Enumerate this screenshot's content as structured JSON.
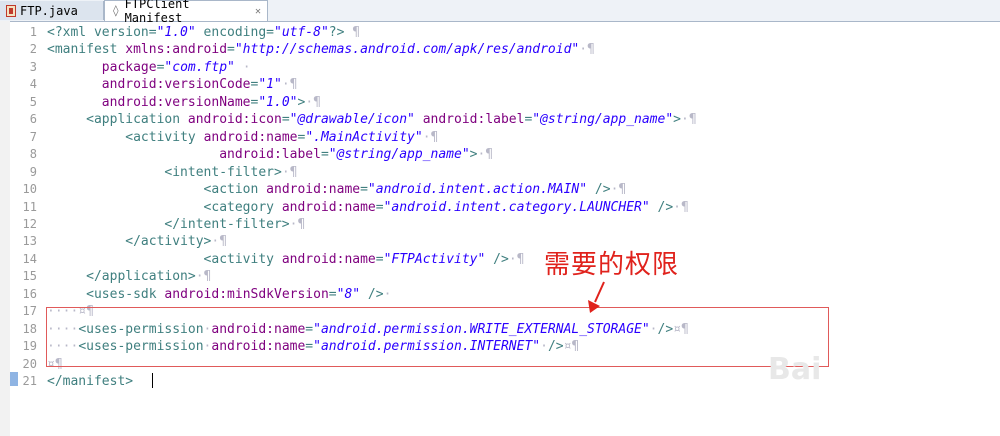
{
  "tabs": [
    {
      "label": "FTP.java",
      "active": false
    },
    {
      "label": "FTPClient Manifest",
      "active": true
    }
  ],
  "tab_close_glyph": "✕",
  "annotation": "需要的权限",
  "watermark": "Bai",
  "colors": {
    "tag": "#3f7f7f",
    "attribute": "#7f007f",
    "value": "#2a00ff",
    "annotation": "#e0221c",
    "highlight_border": "#e05a5a"
  },
  "lines": [
    {
      "n": "1",
      "segs": [
        [
          "pi",
          "<?xml version="
        ],
        [
          "val",
          "\"1.0\""
        ],
        [
          "pi",
          " encoding="
        ],
        [
          "val",
          "\"utf-8\""
        ],
        [
          "pi",
          "?>"
        ],
        [
          "ws",
          " ¶"
        ]
      ]
    },
    {
      "n": "2",
      "segs": [
        [
          "tag",
          "<manifest "
        ],
        [
          "attr",
          "xmlns:android"
        ],
        [
          "tag",
          "="
        ],
        [
          "val",
          "\"http://schemas.android.com/apk/res/android\""
        ],
        [
          "ws",
          "·¶"
        ]
      ]
    },
    {
      "n": "3",
      "segs": [
        [
          "ws",
          "       "
        ],
        [
          "attr",
          "package"
        ],
        [
          "tag",
          "="
        ],
        [
          "val",
          "\"com.ftp\""
        ],
        [
          "ws",
          " ·"
        ]
      ]
    },
    {
      "n": "4",
      "segs": [
        [
          "ws",
          "       "
        ],
        [
          "attr",
          "android:versionCode"
        ],
        [
          "tag",
          "="
        ],
        [
          "val",
          "\"1\""
        ],
        [
          "ws",
          "·¶"
        ]
      ]
    },
    {
      "n": "5",
      "segs": [
        [
          "ws",
          "       "
        ],
        [
          "attr",
          "android:versionName"
        ],
        [
          "tag",
          "="
        ],
        [
          "val",
          "\"1.0\""
        ],
        [
          "tag",
          ">"
        ],
        [
          "ws",
          "·¶"
        ]
      ]
    },
    {
      "n": "6",
      "segs": [
        [
          "ws",
          "     "
        ],
        [
          "tag",
          "<application "
        ],
        [
          "attr",
          "android:icon"
        ],
        [
          "tag",
          "="
        ],
        [
          "val",
          "\"@drawable/icon\""
        ],
        [
          "tag",
          " "
        ],
        [
          "attr",
          "android:label"
        ],
        [
          "tag",
          "="
        ],
        [
          "val",
          "\"@string/app_name\""
        ],
        [
          "tag",
          ">"
        ],
        [
          "ws",
          "·¶"
        ]
      ]
    },
    {
      "n": "7",
      "segs": [
        [
          "ws",
          "          "
        ],
        [
          "tag",
          "<activity "
        ],
        [
          "attr",
          "android:name"
        ],
        [
          "tag",
          "="
        ],
        [
          "val",
          "\".MainActivity\""
        ],
        [
          "ws",
          "·¶"
        ]
      ]
    },
    {
      "n": "8",
      "segs": [
        [
          "ws",
          "                      "
        ],
        [
          "attr",
          "android:label"
        ],
        [
          "tag",
          "="
        ],
        [
          "val",
          "\"@string/app_name\""
        ],
        [
          "tag",
          ">"
        ],
        [
          "ws",
          "·¶"
        ]
      ]
    },
    {
      "n": "9",
      "segs": [
        [
          "ws",
          "               "
        ],
        [
          "tag",
          "<intent-filter>"
        ],
        [
          "ws",
          "·¶"
        ]
      ]
    },
    {
      "n": "10",
      "segs": [
        [
          "ws",
          "                    "
        ],
        [
          "tag",
          "<action "
        ],
        [
          "attr",
          "android:name"
        ],
        [
          "tag",
          "="
        ],
        [
          "val",
          "\"android.intent.action.MAIN\""
        ],
        [
          "tag",
          " />"
        ],
        [
          "ws",
          "·¶"
        ]
      ]
    },
    {
      "n": "11",
      "segs": [
        [
          "ws",
          "                    "
        ],
        [
          "tag",
          "<category "
        ],
        [
          "attr",
          "android:name"
        ],
        [
          "tag",
          "="
        ],
        [
          "val",
          "\"android.intent.category.LAUNCHER\""
        ],
        [
          "tag",
          " />"
        ],
        [
          "ws",
          "·¶"
        ]
      ]
    },
    {
      "n": "12",
      "segs": [
        [
          "ws",
          "               "
        ],
        [
          "tag",
          "</intent-filter>"
        ],
        [
          "ws",
          "·¶"
        ]
      ]
    },
    {
      "n": "13",
      "segs": [
        [
          "ws",
          "          "
        ],
        [
          "tag",
          "</activity>"
        ],
        [
          "ws",
          "·¶"
        ]
      ]
    },
    {
      "n": "14",
      "segs": [
        [
          "ws",
          "                    "
        ],
        [
          "tag",
          "<activity "
        ],
        [
          "attr",
          "android:name"
        ],
        [
          "tag",
          "="
        ],
        [
          "val",
          "\"FTPActivity\""
        ],
        [
          "tag",
          " />"
        ],
        [
          "ws",
          "·¶"
        ]
      ]
    },
    {
      "n": "15",
      "segs": [
        [
          "ws",
          "     "
        ],
        [
          "tag",
          "</application>"
        ],
        [
          "ws",
          "·¶"
        ]
      ]
    },
    {
      "n": "16",
      "segs": [
        [
          "ws",
          "     "
        ],
        [
          "tag",
          "<uses-sdk "
        ],
        [
          "attr",
          "android:minSdkVersion"
        ],
        [
          "tag",
          "="
        ],
        [
          "val",
          "\"8\""
        ],
        [
          "tag",
          " />"
        ],
        [
          "ws",
          "·"
        ]
      ]
    },
    {
      "n": "17",
      "segs": [
        [
          "ws",
          "····¤¶"
        ]
      ]
    },
    {
      "n": "18",
      "segs": [
        [
          "ws",
          "····"
        ],
        [
          "tag",
          "<uses-permission"
        ],
        [
          "ws",
          "·"
        ],
        [
          "attr",
          "android:name"
        ],
        [
          "tag",
          "="
        ],
        [
          "val",
          "\"android.permission.WRITE_EXTERNAL_STORAGE\""
        ],
        [
          "ws",
          "·"
        ],
        [
          "tag",
          "/>"
        ],
        [
          "ws",
          "¤¶"
        ]
      ]
    },
    {
      "n": "19",
      "segs": [
        [
          "ws",
          "····"
        ],
        [
          "tag",
          "<uses-permission"
        ],
        [
          "ws",
          "·"
        ],
        [
          "attr",
          "android:name"
        ],
        [
          "tag",
          "="
        ],
        [
          "val",
          "\"android.permission.INTERNET\""
        ],
        [
          "ws",
          "·"
        ],
        [
          "tag",
          "/>"
        ],
        [
          "ws",
          "¤¶"
        ]
      ]
    },
    {
      "n": "20",
      "segs": [
        [
          "ws",
          "¤¶"
        ]
      ]
    },
    {
      "n": "21",
      "segs": [
        [
          "tag",
          "</manifest>"
        ],
        [
          "ws",
          " "
        ]
      ]
    }
  ]
}
